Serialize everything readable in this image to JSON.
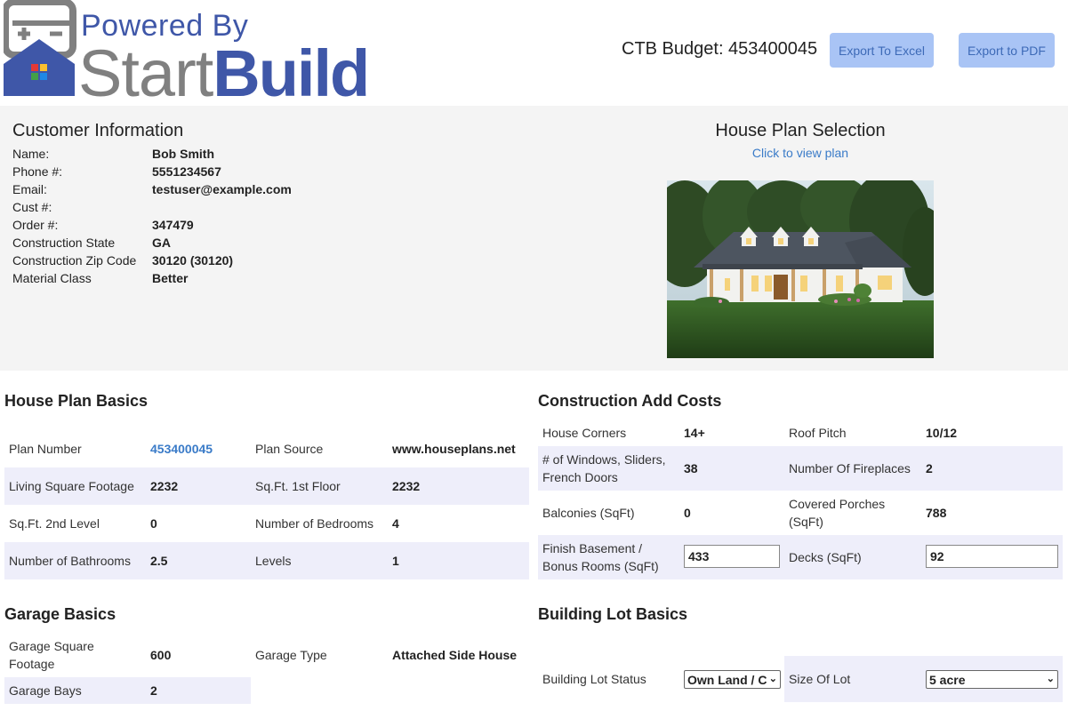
{
  "header": {
    "logo_powered": "Powered By",
    "logo_start": "Start",
    "logo_build": "Build",
    "budget_text": "CTB Budget: 453400045",
    "export_excel": "Export To Excel",
    "export_pdf": "Export to PDF"
  },
  "customer": {
    "title": "Customer Information",
    "rows": [
      {
        "label": "Name:",
        "value": "Bob Smith"
      },
      {
        "label": "Phone #:",
        "value": "5551234567"
      },
      {
        "label": "Email:",
        "value": "testuser@example.com"
      },
      {
        "label": "Cust #:",
        "value": ""
      },
      {
        "label": "Order #:",
        "value": "347479"
      },
      {
        "label": "Construction State",
        "value": "GA"
      },
      {
        "label": "Construction Zip Code",
        "value": "30120 (30120)"
      },
      {
        "label": "Material Class",
        "value": "Better"
      }
    ]
  },
  "plan_selection": {
    "title": "House Plan Selection",
    "link": "Click to view plan",
    "image": "house-photo"
  },
  "house_plan_basics": {
    "title": "House Plan Basics",
    "rows": [
      {
        "l1": "Plan Number",
        "v1": "453400045",
        "l2": "Plan Source",
        "v2": "www.houseplans.net"
      },
      {
        "l1": "Living Square Footage",
        "v1": "2232",
        "l2": "Sq.Ft. 1st Floor",
        "v2": "2232"
      },
      {
        "l1": "Sq.Ft. 2nd Level",
        "v1": "0",
        "l2": "Number of Bedrooms",
        "v2": "4"
      },
      {
        "l1": "Number of Bathrooms",
        "v1": "2.5",
        "l2": "Levels",
        "v2": "1"
      }
    ]
  },
  "construction_add_costs": {
    "title": "Construction Add Costs",
    "rows": [
      {
        "l1": "House Corners",
        "v1": "14+",
        "l2": "Roof Pitch",
        "v2": "10/12"
      },
      {
        "l1": "# of Windows, Sliders, French Doors",
        "v1": "38",
        "l2": "Number Of Fireplaces",
        "v2": "2"
      },
      {
        "l1": "Balconies (SqFt)",
        "v1": "0",
        "l2": "Covered Porches (SqFt)",
        "v2": "788"
      },
      {
        "l1": "Finish Basement / Bonus Rooms (SqFt)",
        "v1": "433",
        "l2": "Decks (SqFt)",
        "v2": "92"
      }
    ]
  },
  "garage_basics": {
    "title": "Garage Basics",
    "rows": [
      {
        "l1": "Garage Square Footage",
        "v1": "600",
        "l2": "Garage Type",
        "v2": "Attached Side House"
      },
      {
        "l1": "Garage Bays",
        "v1": "2"
      }
    ]
  },
  "building_lot_basics": {
    "title": "Building Lot Basics",
    "status_label": "Building Lot Status",
    "status_value": "Own Land / C",
    "size_label": "Size Of Lot",
    "size_value": "5 acre"
  },
  "colors": {
    "accent": "#3f57a8",
    "link": "#3a7bc8",
    "button_bg": "#a9c4f5",
    "row_shade": "#eeeefa",
    "band_bg": "#f4f4f4"
  }
}
